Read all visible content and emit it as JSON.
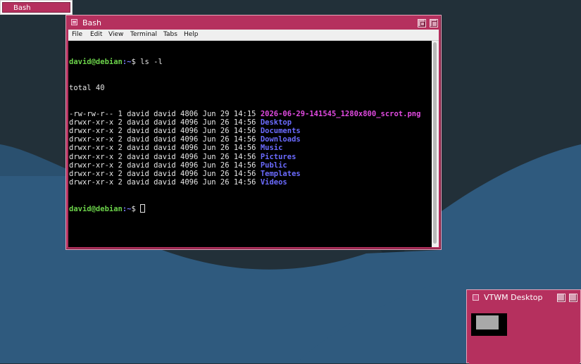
{
  "icon_manager": {
    "item_label": "Bash"
  },
  "terminal": {
    "title": "Bash",
    "menu": [
      "File",
      "Edit",
      "View",
      "Terminal",
      "Tabs",
      "Help"
    ],
    "prompt_user": "david@debian",
    "prompt_path": ":~",
    "prompt_symbol": "$ ",
    "command": "ls -l",
    "total": "total 40",
    "entries": [
      {
        "perms": "-rw-rw-r-- 1 david david 4806 Jun 29 14:15 ",
        "name": "2026-06-29-141545_1280x800_scrot.png",
        "kind": "file"
      },
      {
        "perms": "drwxr-xr-x 2 david david 4096 Jun 26 14:56 ",
        "name": "Desktop",
        "kind": "dir"
      },
      {
        "perms": "drwxr-xr-x 2 david david 4096 Jun 26 14:56 ",
        "name": "Documents",
        "kind": "dir"
      },
      {
        "perms": "drwxr-xr-x 2 david david 4096 Jun 26 14:56 ",
        "name": "Downloads",
        "kind": "dir"
      },
      {
        "perms": "drwxr-xr-x 2 david david 4096 Jun 26 14:56 ",
        "name": "Music",
        "kind": "dir"
      },
      {
        "perms": "drwxr-xr-x 2 david david 4096 Jun 26 14:56 ",
        "name": "Pictures",
        "kind": "dir"
      },
      {
        "perms": "drwxr-xr-x 2 david david 4096 Jun 26 14:56 ",
        "name": "Public",
        "kind": "dir"
      },
      {
        "perms": "drwxr-xr-x 2 david david 4096 Jun 26 14:56 ",
        "name": "Templates",
        "kind": "dir"
      },
      {
        "perms": "drwxr-xr-x 2 david david 4096 Jun 26 14:56 ",
        "name": "Videos",
        "kind": "dir"
      }
    ]
  },
  "panner": {
    "title": "VTWM Desktop"
  },
  "colors": {
    "window_frame": "#b5305e",
    "desktop_dark": "#223039",
    "desktop_blue": "#2f5a7e",
    "prompt_green": "#6cd34a",
    "dir_blue": "#6b6bff",
    "file_magenta": "#e04ae0"
  }
}
